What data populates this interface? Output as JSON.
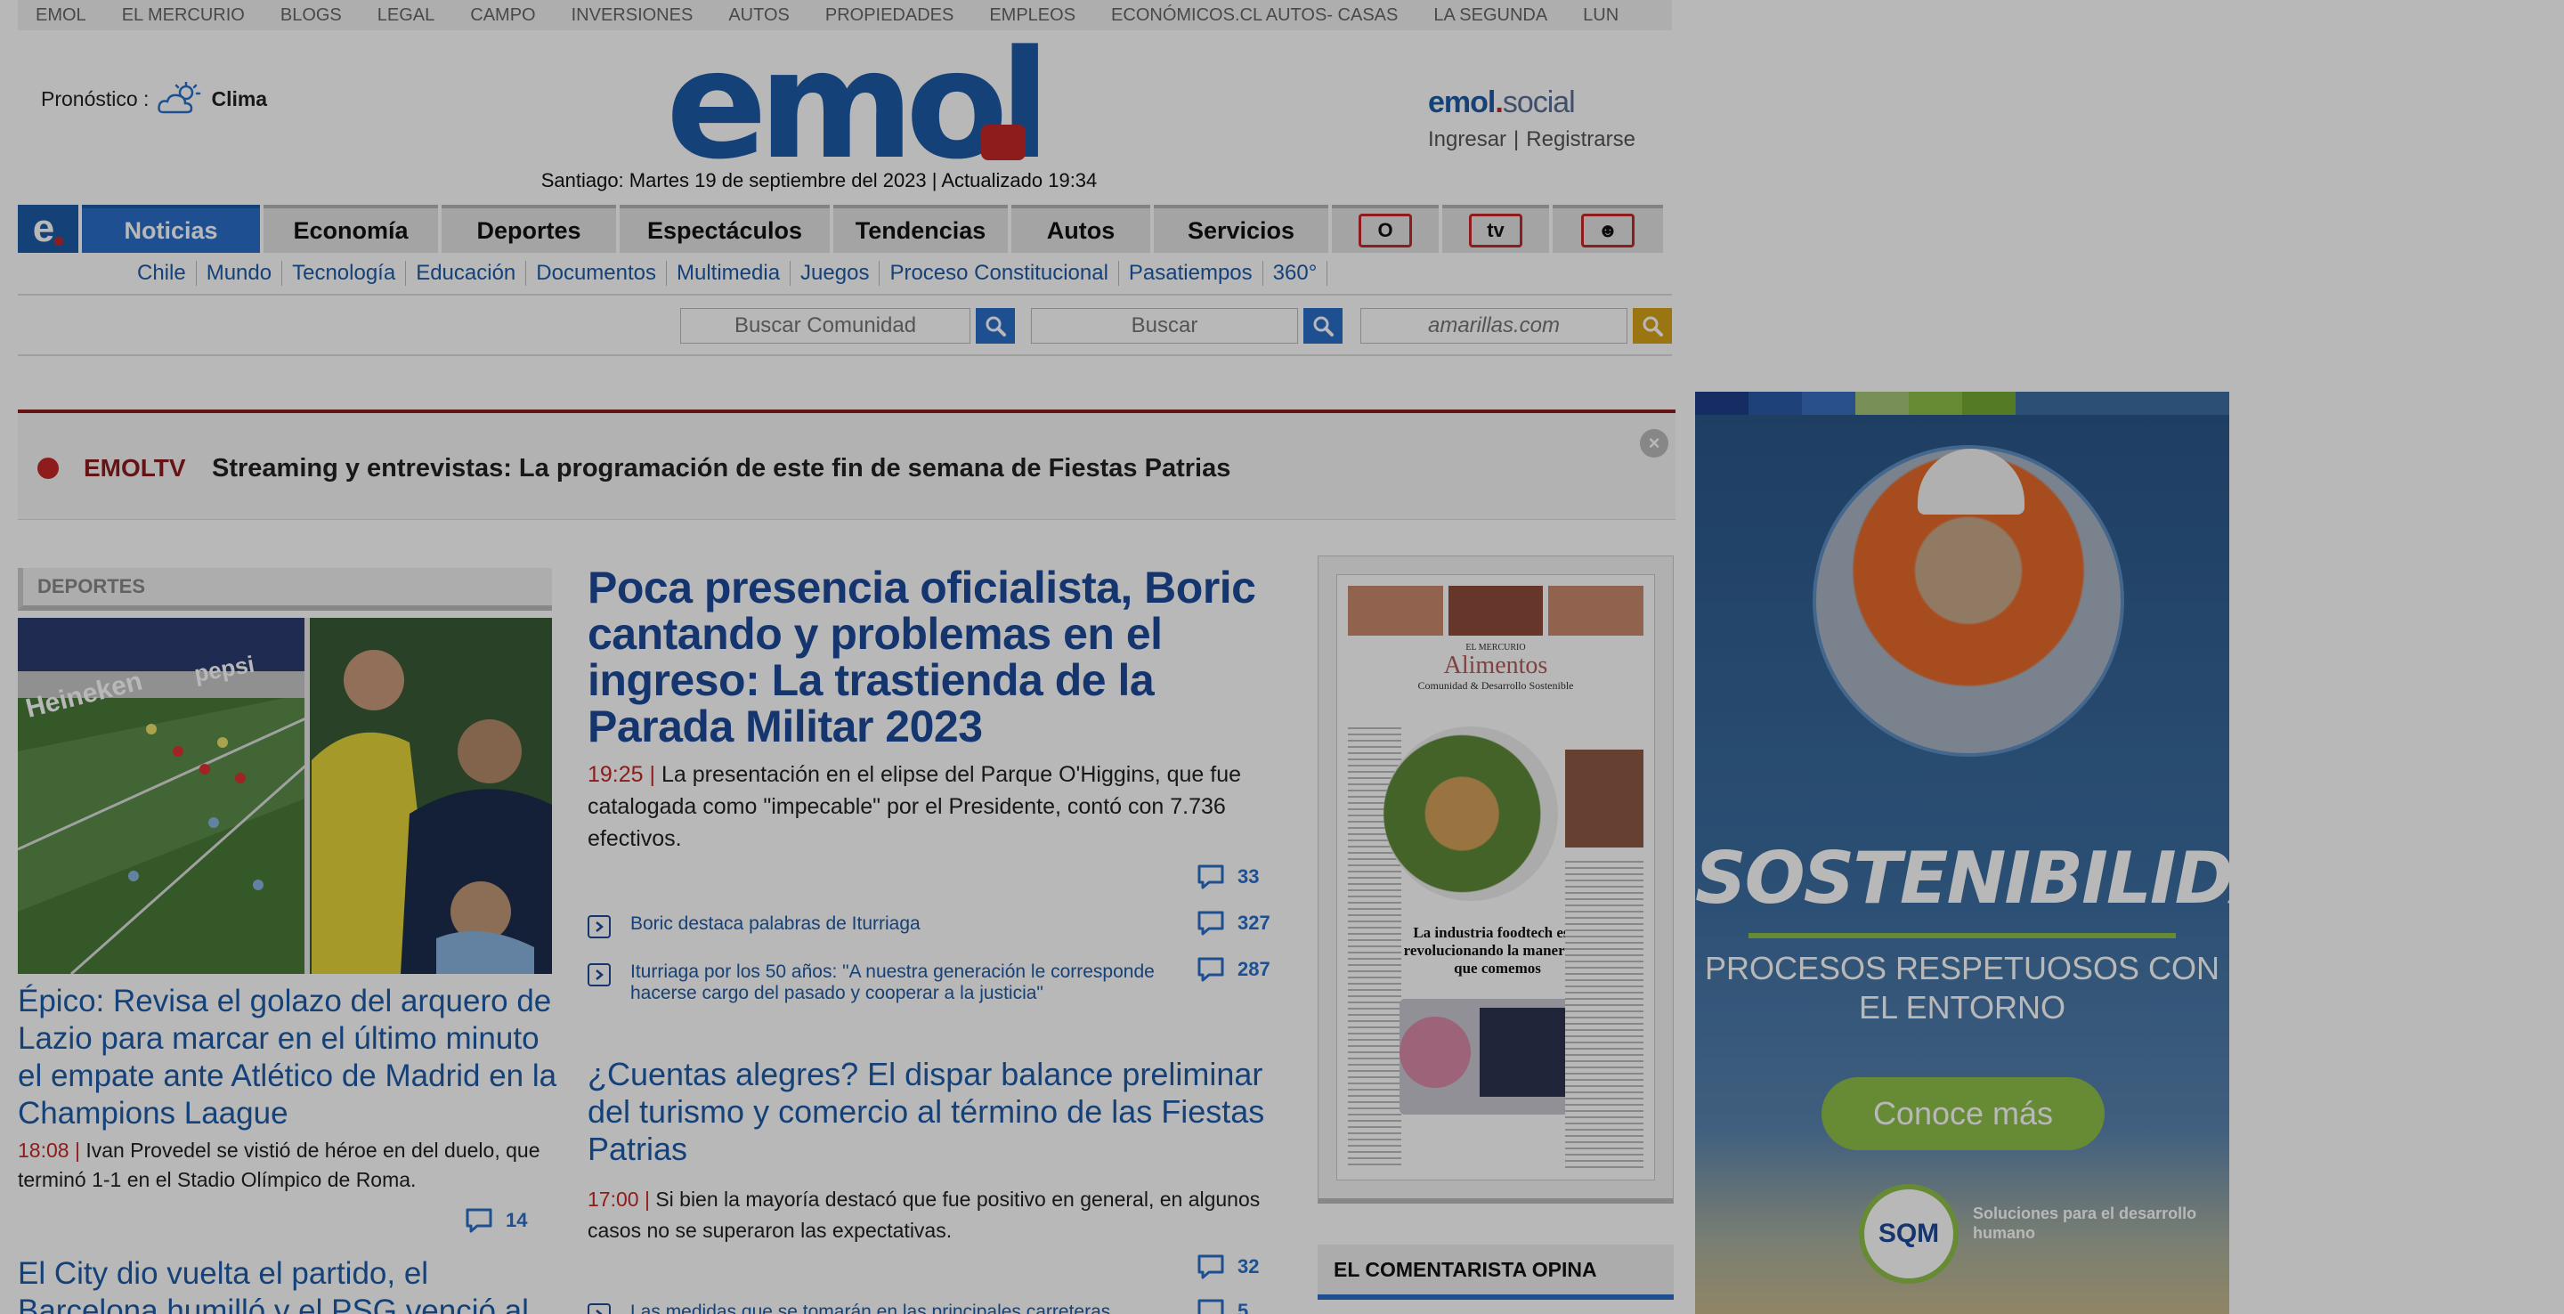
{
  "topbar": {
    "links": [
      "EMOL",
      "EL MERCURIO",
      "BLOGS",
      "LEGAL",
      "CAMPO",
      "INVERSIONES",
      "AUTOS",
      "PROPIEDADES",
      "EMPLEOS",
      "ECONÓMICOS.CL AUTOS- CASAS",
      "LA SEGUNDA",
      "LUN"
    ]
  },
  "forecast": {
    "label": "Pronóstico :",
    "link": "Clima",
    "icon": "weather-cloud-icon"
  },
  "logo": {
    "text": "emol"
  },
  "dateline": "Santiago: Martes 19 de septiembre del 2023 | Actualizado 19:34",
  "social": {
    "brand": "emol",
    "brand_suffix": "social",
    "login": "Ingresar",
    "separator": "|",
    "register": "Registrarse"
  },
  "mainnav": {
    "home_label": "e",
    "items": [
      "Noticias",
      "Economía",
      "Deportes",
      "Espectáculos",
      "Tendencias",
      "Autos",
      "Servicios"
    ],
    "icons": [
      "radio-icon",
      "tv-icon",
      "community-icon"
    ],
    "icon_labels": [
      "O",
      "tv",
      "☻"
    ]
  },
  "subnav": {
    "items": [
      "Chile",
      "Mundo",
      "Tecnología",
      "Educación",
      "Documentos",
      "Multimedia",
      "Juegos",
      "Proceso Constitucional",
      "Pasatiempos",
      "360°"
    ]
  },
  "search": {
    "community_placeholder": "Buscar Comunidad",
    "main_placeholder": "Buscar",
    "amarillas_placeholder": "amarillas.com"
  },
  "breaking": {
    "label": "EMOLTV",
    "headline": "Streaming y entrevistas: La programación de este fin de semana de Fiestas Patrias",
    "close": "×"
  },
  "left": {
    "section": "DEPORTES",
    "title": "Épico: Revisa el golazo del arquero de Lazio para marcar en el último minuto el empate ante Atlético de Madrid en la Champions Laague",
    "time": "18:08 |",
    "summary": "Ivan Provedel se vistió de héroe en del duelo, que terminó 1-1 en el Stadio Olímpico de Roma.",
    "comments": "14",
    "title2": "El City dio vuelta el partido, el Barcelona humilló y el PSG venció al"
  },
  "main": {
    "headline": "Poca presencia oficialista, Boric cantando y problemas en el ingreso: La trastienda de la Parada Militar 2023",
    "time": "19:25 |",
    "summary": "La presentación en el elipse del Parque O'Higgins, que fue catalogada como \"impecable\" por el Presidente, contó con 7.736 efectivos.",
    "comments": "33",
    "related": [
      {
        "text": "Boric destaca palabras de Iturriaga",
        "comments": "327"
      },
      {
        "text": "Iturriaga por los 50 años: \"A nuestra generación le corresponde hacerse cargo del pasado y cooperar a la justicia\"",
        "comments": "287"
      }
    ],
    "headline2": "¿Cuentas alegres? El dispar balance preliminar del turismo y comercio al término de las Fiestas Patrias",
    "time2": "17:00 |",
    "summary2": "Si bien la mayoría destacó que fue positivo en general, en algunos casos no se superaron las expectativas.",
    "comments2": "32",
    "related2": {
      "text": "Las medidas que se tomarán en las principales carreteras",
      "comments": "5"
    }
  },
  "paper": {
    "small": "EL MERCURIO",
    "title": "Alimentos",
    "subtitle": "Comunidad & Desarrollo Sostenible",
    "caption": "La industria foodtech está revolucionando la manera en que comemos"
  },
  "opina": {
    "title": "EL COMENTARISTA OPINA"
  },
  "ad": {
    "title": "SOSTENIBILIDAD",
    "text": "PROCESOS RESPETUOSOS CON EL ENTORNO",
    "cta": "Conoce más",
    "logo": "SQM",
    "tagline": "Soluciones para el desarrollo humano",
    "bar_colors": [
      "#1f3f8a",
      "#2a5aa8",
      "#3a6fc0",
      "#a7c77a",
      "#8fbf4a",
      "#77aa34",
      "#3d6fa2",
      "#3d6fa2",
      "#3d6fa2",
      "#3d6fa2"
    ]
  }
}
